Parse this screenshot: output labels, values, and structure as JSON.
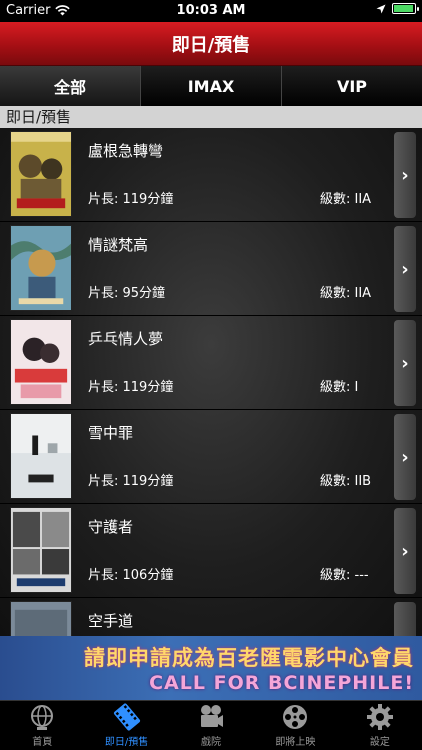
{
  "status_bar": {
    "carrier": "Carrier",
    "time": "10:03 AM",
    "battery_level": 0.95
  },
  "nav": {
    "title": "即日/預售"
  },
  "segments": [
    {
      "label": "全部",
      "active": true
    },
    {
      "label": "IMAX",
      "active": false
    },
    {
      "label": "VIP",
      "active": false
    }
  ],
  "section": {
    "header": "即日/預售"
  },
  "movies": [
    {
      "title": "盧根急轉彎",
      "length": "片長: 119分鐘",
      "rating": "級數: IIA",
      "poster_icon": "movie-poster"
    },
    {
      "title": "情謎梵高",
      "length": "片長: 95分鐘",
      "rating": "級數: IIA",
      "poster_icon": "movie-poster"
    },
    {
      "title": "乒乓情人夢",
      "length": "片長: 119分鐘",
      "rating": "級數: I",
      "poster_icon": "movie-poster"
    },
    {
      "title": "雪中罪",
      "length": "片長: 119分鐘",
      "rating": "級數: IIB",
      "poster_icon": "movie-poster"
    },
    {
      "title": "守護者",
      "length": "片長: 106分鐘",
      "rating": "級數: ---",
      "poster_icon": "movie-poster"
    },
    {
      "title": "空手道",
      "length": "",
      "rating": "",
      "poster_icon": "movie-poster"
    }
  ],
  "banner": {
    "line1": "請即申請成為百老匯電影中心會員",
    "line2": "CALL FOR BCINEPHILE!"
  },
  "tabs": [
    {
      "label": "首頁",
      "icon": "globe-icon",
      "active": false
    },
    {
      "label": "即日/預售",
      "icon": "film-strip-icon",
      "active": true
    },
    {
      "label": "戲院",
      "icon": "camera-icon",
      "active": false
    },
    {
      "label": "即將上映",
      "icon": "film-reel-icon",
      "active": false
    },
    {
      "label": "設定",
      "icon": "gear-icon",
      "active": false
    }
  ],
  "colors": {
    "accent_red": "#c8161c",
    "tab_active": "#2f8fff",
    "banner_blue": "#3c6fb6"
  }
}
